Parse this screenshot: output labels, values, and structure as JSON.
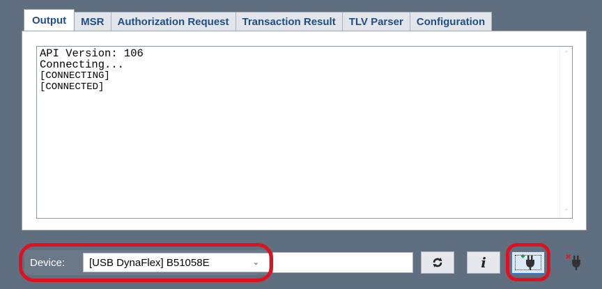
{
  "tabs": [
    {
      "label": "Output",
      "active": true
    },
    {
      "label": "MSR",
      "active": false
    },
    {
      "label": "Authorization Request",
      "active": false
    },
    {
      "label": "Transaction Result",
      "active": false
    },
    {
      "label": "TLV Parser",
      "active": false
    },
    {
      "label": "Configuration",
      "active": false
    }
  ],
  "output": {
    "lines": [
      "API Version: 106",
      "Connecting...",
      "[CONNECTING]",
      "[CONNECTED]"
    ]
  },
  "device": {
    "label": "Device:",
    "selected": "[USB DynaFlex] B51058E",
    "input_value": ""
  },
  "buttons": {
    "refresh_icon": "refresh-icon",
    "info_icon": "info-icon",
    "info_glyph": "i",
    "connect_icon": "plug-connect-icon",
    "disconnect_icon": "plug-disconnect-icon"
  },
  "colors": {
    "background": "#5f6f7f",
    "tab_text": "#1f4d8a",
    "highlight": "#e0101e",
    "connect_accent": "#3b7fd1",
    "plug_green": "#1aa34a",
    "plug_red": "#d62020"
  }
}
